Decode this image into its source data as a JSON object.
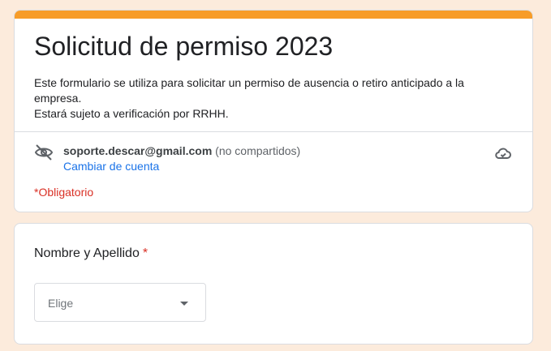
{
  "form": {
    "title": "Solicitud de permiso 2023",
    "description_line1": "Este formulario se utiliza para solicitar un permiso de ausencia o retiro anticipado a la empresa.",
    "description_line2": "Estará sujeto a verificación por RRHH.",
    "accent_color": "#f79c28"
  },
  "account": {
    "email": "soporte.descar@gmail.com",
    "shared_note": "(no compartidos)",
    "switch_label": "Cambiar de cuenta",
    "left_icon": "eye-off-icon",
    "right_icon": "cloud-done-icon"
  },
  "required_note": "*Obligatorio",
  "question": {
    "label": "Nombre y Apellido",
    "required_mark": "*",
    "dropdown_placeholder": "Elige",
    "dropdown_icon": "caret-down-icon"
  }
}
